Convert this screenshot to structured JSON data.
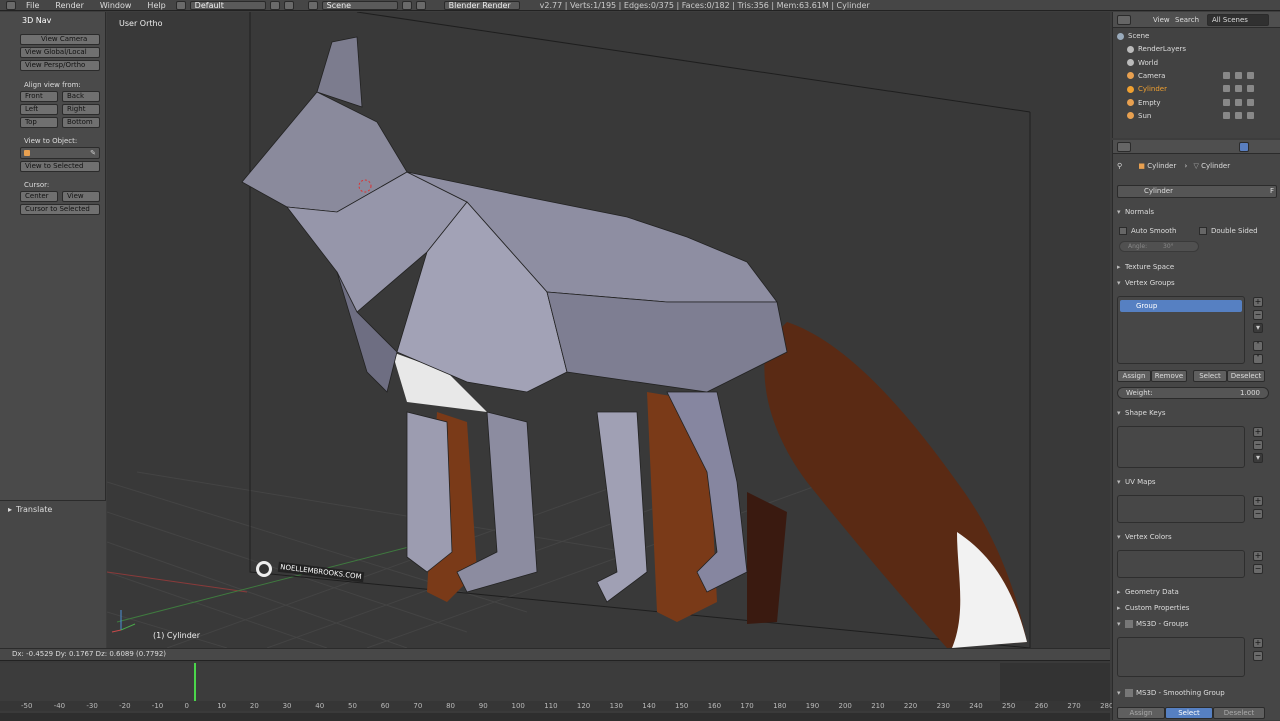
{
  "topbar": {
    "menus": [
      "File",
      "Render",
      "Window",
      "Help"
    ],
    "screen_layout": "Default",
    "scene": "Scene",
    "render_engine": "Blender Render",
    "stats": "v2.77 | Verts:1/195 | Edges:0/375 | Faces:0/182 | Tris:356 | Mem:63.61M | Cylinder"
  },
  "toolshelf": {
    "panel_title": "3D Nav",
    "view_camera": "View Camera",
    "view_global_local": "View Global/Local",
    "view_persp_ortho": "View Persp/Ortho",
    "align_label": "Align view from:",
    "front": "Front",
    "back": "Back",
    "left": "Left",
    "right": "Right",
    "top": "Top",
    "bottom": "Bottom",
    "view_to_object_label": "View to Object:",
    "view_to_selected": "View to Selected",
    "cursor_label": "Cursor:",
    "center": "Center",
    "view": "View",
    "cursor_to_selected": "Cursor to Selected",
    "operator_panel": "Translate"
  },
  "viewport": {
    "view_label": "User Ortho",
    "object_label": "(1) Cylinder",
    "watermark": "NOELLEMBROOKS.COM"
  },
  "infobar": {
    "delta_text": "Dx: -0.4529   Dy: 0.1767   Dz: 0.6089 (0.7792)"
  },
  "timeline": {
    "ticks": [
      "-50",
      "-40",
      "-30",
      "-20",
      "-10",
      "0",
      "10",
      "20",
      "30",
      "40",
      "50",
      "60",
      "70",
      "80",
      "90",
      "100",
      "110",
      "120",
      "130",
      "140",
      "150",
      "160",
      "170",
      "180",
      "190",
      "200",
      "210",
      "220",
      "230",
      "240",
      "250",
      "260",
      "270",
      "280"
    ]
  },
  "outliner": {
    "view": "View",
    "search": "Search",
    "filter": "All Scenes",
    "items": [
      {
        "label": "Scene",
        "color": "#9ab"
      },
      {
        "label": "RenderLayers",
        "color": "#bbb"
      },
      {
        "label": "World",
        "color": "#bbb"
      },
      {
        "label": "Camera",
        "color": "#e8a050"
      },
      {
        "label": "Cylinder",
        "color": "#f0a030"
      },
      {
        "label": "Empty",
        "color": "#e8a050"
      },
      {
        "label": "Sun",
        "color": "#e8a050"
      }
    ]
  },
  "properties": {
    "breadcrumb_object": "Cylinder",
    "breadcrumb_mesh": "Cylinder",
    "mesh_name": "Cylinder",
    "mesh_fake_user": "F",
    "normals": "Normals",
    "auto_smooth": "Auto Smooth",
    "double_sided": "Double Sided",
    "angle": "Angle:",
    "angle_value": "30°",
    "texture_space": "Texture Space",
    "vertex_groups": "Vertex Groups",
    "group_item": "Group",
    "assign": "Assign",
    "remove": "Remove",
    "select": "Select",
    "deselect": "Deselect",
    "weight_label": "Weight:",
    "weight_value": "1.000",
    "shape_keys": "Shape Keys",
    "uv_maps": "UV Maps",
    "vertex_colors": "Vertex Colors",
    "geometry_data": "Geometry Data",
    "custom_properties": "Custom Properties",
    "ms3d_groups": "MS3D - Groups",
    "ms3d_smoothing": "MS3D - Smoothing Group",
    "bottom_assign": "Assign",
    "bottom_select": "Select",
    "bottom_deselect": "Deselect"
  }
}
